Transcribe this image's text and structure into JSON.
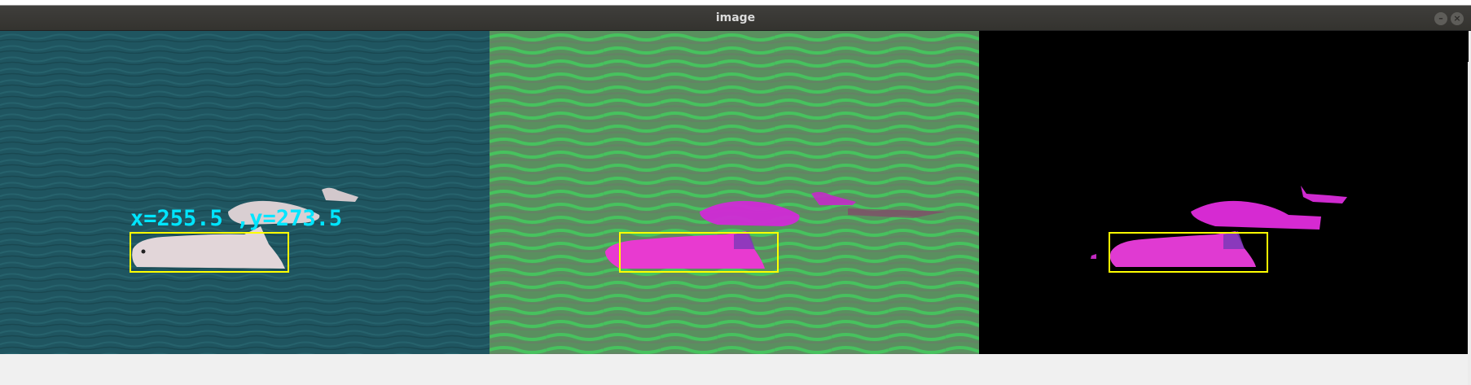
{
  "window": {
    "title": "image",
    "minimize_glyph": "–",
    "close_glyph": "×"
  },
  "panels": {
    "original": {
      "overlay_text": "x=255.5 ,y=273.5",
      "overlay_color": "#00e5ff",
      "box_color": "#ffff00"
    },
    "hsv": {
      "box_color": "#ffff00"
    },
    "mask": {
      "box_color": "#ffff00"
    }
  }
}
